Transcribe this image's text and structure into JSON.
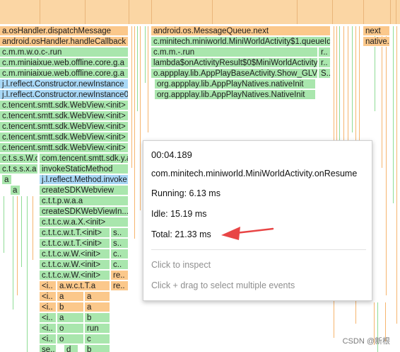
{
  "flame": {
    "top_left": [
      "a.osHandler.dispatchMessage",
      "android.osHandler.handleCallback",
      "c.m.m.w.o.c-.run",
      "c.m.miniaixue.web.offline.core.g.a",
      "c.m.miniaixue.web.offline.core.g.a",
      "j.l.reflect.Constructor.newInstance",
      "j.l.reflect.Constructor.newInstance0",
      "c.tencent.smtt.sdk.WebView.<init>",
      "c.tencent.smtt.sdk.WebView.<init>",
      "c.tencent.smtt.sdk.WebView.<init>",
      "c.tencent.smtt.sdk.WebView.<init>",
      "c.tencent.smtt.sdk.WebView.<init>"
    ],
    "mid_left": [
      {
        "a": "c.t.s.s.W.c",
        "b": "com.tencent.smtt.sdk.y.a"
      },
      {
        "a": "c.t.s.s.x.a",
        "b": "invokeStaticMethod"
      },
      {
        "a": "a",
        "b": "j.l.reflect.Method.invoke"
      },
      {
        "a": "a",
        "b": "createSDKWebview"
      }
    ],
    "col_b": [
      "c.t.t.p.w.a.a",
      "createSDKWebViewIn...",
      "c.t.t.c.w.a.X.<init>",
      "c.t.t.c.w.t.T.<init>",
      "c.t.t.c.w.t.T.<init>",
      "c.t.t.c.w.W.<init>",
      "c.t.t.c.w.W.<init>",
      "c.t.t.c.w.W.<init>"
    ],
    "col_c": [
      "s..",
      "s..",
      "c..",
      "c..",
      "re..",
      "re.."
    ],
    "deep": [
      {
        "a": "<i..",
        "b": "a.w.c.t.T.a",
        "c": ""
      },
      {
        "a": "<i..",
        "b": "a",
        "c": "a"
      },
      {
        "a": "<i..",
        "b": "b",
        "c": "a"
      },
      {
        "a": "<i..",
        "b": "a",
        "c": "b"
      },
      {
        "a": "<i..",
        "b": "o",
        "c": "run"
      },
      {
        "a": "<i..",
        "b": "o",
        "c": "c"
      },
      {
        "a": "se..",
        "b": "d",
        "c": "b"
      }
    ],
    "right": [
      "android.os.MessageQueue.next",
      "c.minitech.miniworld.MiniWorldActivity$1.queueIdle",
      "c.m.m.-.run",
      "lambda$onActivityResult$0$MiniWorldActivity",
      "o.appplay.lib.AppPlayBaseActivity.Show_GLView",
      "org.appplay.lib.AppPlayNatives.nativeInit",
      "org.appplay.lib.AppPlayNatives.NativeInit"
    ],
    "right_side": [
      "r..",
      "r..",
      "S.."
    ],
    "far_right": [
      "next",
      "native..."
    ]
  },
  "tooltip": {
    "duration": "00:04.189",
    "method": "com.minitech.miniworld.MiniWorldActivity.onResume",
    "running": "Running: 6.13 ms",
    "idle": "Idle: 15.19 ms",
    "total": "Total: 21.33 ms",
    "hint_inspect": "Click to inspect",
    "hint_drag": "Click + drag to select multiple events"
  },
  "watermark": "CSDN @新根",
  "colors": {
    "orange": "#fbc88b",
    "green": "#a9e6ad",
    "blue": "#a9d8f6",
    "arrow": "#e84545"
  }
}
